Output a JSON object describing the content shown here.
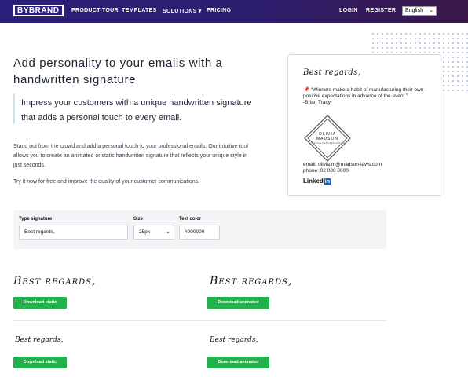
{
  "nav": {
    "logo": "BYBRAND",
    "links": [
      "PRODUCT TOUR",
      "TEMPLATES",
      "SOLUTIONS ▾",
      "PRICING"
    ],
    "login": "LOGIN",
    "register": "REGISTER",
    "language": "English"
  },
  "hero": {
    "title": "Add personality to your emails with a handwritten signature",
    "quote": "Impress your customers with a unique handwritten signature that adds a personal touch to every email.",
    "paragraph1": "Stand out from the crowd and add a personal touch to your professional emails. Our intuitive tool allows you to create an animated or static handwritten signature that reflects your unique style in just seconds.",
    "paragraph2": "Try it now for free and improve the quality of your customer communications."
  },
  "card": {
    "signature": "Best regards,",
    "quote": "“Winners make a habit of manufacturing their own positive expectations in advance of the event.”",
    "author": "-Brian Tracy",
    "logo_name_line1": "OLIVIA",
    "logo_name_line2": "MADSON",
    "logo_sub": "INTERNAL DESIGNER CENTER",
    "email": "email: olivia.m@madson-laws.com",
    "phone": "phone: 02 000 0000",
    "linkedin_text": "Linked",
    "linkedin_badge": "in"
  },
  "controls": {
    "type_label": "Type signature",
    "type_value": "Best regards,",
    "size_label": "Size",
    "size_value": "25px",
    "color_label": "Text color",
    "color_value": "#000000"
  },
  "previews": {
    "sig_static_large": "Best regards,",
    "sig_animated_large": "Best regards,",
    "sig_static_small": "Best regards,",
    "sig_animated_small": "Best regards,",
    "download_static": "Download static",
    "download_animated": "Download animated"
  },
  "colors": {
    "nav_bg": "#2a1f7a",
    "accent_green": "#22b14c",
    "linkedin_blue": "#0a66c2"
  }
}
